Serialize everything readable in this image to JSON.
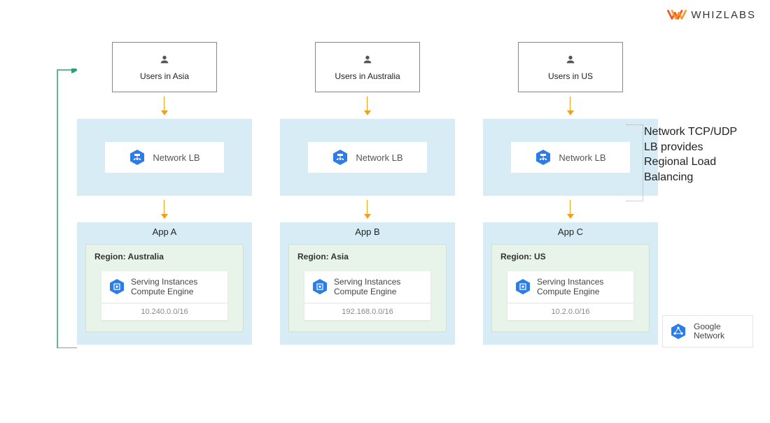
{
  "brand": {
    "name": "WHIZLABS"
  },
  "annotation": "Network TCP/UDP LB provides Regional Load Balancing",
  "legend": {
    "label": "Google Network"
  },
  "lb_label": "Network LB",
  "serving_label_line1": "Serving Instances",
  "serving_label_line2": "Compute Engine",
  "columns": [
    {
      "users_label": "Users in Asia",
      "app_label": "App A",
      "region_label": "Region: Australia",
      "ip": "10.240.0.0/16"
    },
    {
      "users_label": "Users in Australia",
      "app_label": "App B",
      "region_label": "Region: Asia",
      "ip": "192.168.0.0/16"
    },
    {
      "users_label": "Users in US",
      "app_label": "App C",
      "region_label": "Region: US",
      "ip": "10.2.0.0/16"
    }
  ]
}
